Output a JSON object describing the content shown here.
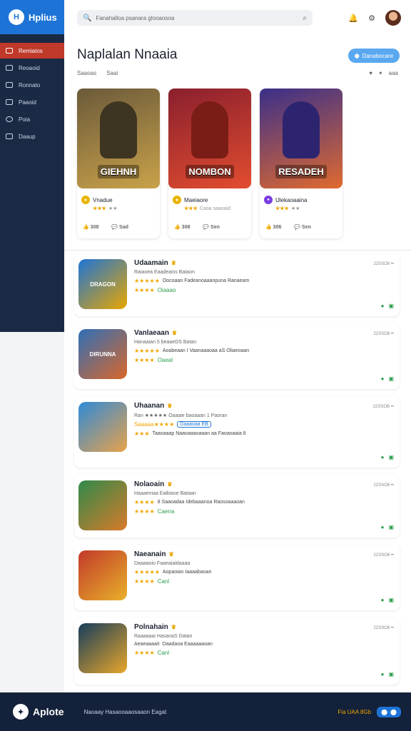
{
  "brand": {
    "name": "Hplius",
    "mark": "H"
  },
  "sidebar": {
    "items": [
      {
        "label": "Remiatos",
        "icon": "gamepad-icon"
      },
      {
        "label": "Reoaoid",
        "icon": "monitor-icon"
      },
      {
        "label": "Ronnato",
        "icon": "book-icon"
      },
      {
        "label": "Paaoid",
        "icon": "card-icon"
      },
      {
        "label": "Poia",
        "icon": "circle-icon"
      },
      {
        "label": "Daaup",
        "icon": "folder-icon"
      }
    ]
  },
  "header": {
    "search_value": "Fanahalloa psanara glooaosoa",
    "search_icon": "🔍",
    "search_action_icon": "⌕",
    "icons": [
      "🔔",
      "⚙"
    ]
  },
  "main": {
    "title": "Naplalan Nnaaia",
    "primary_button": "Danabocare",
    "primary_button_icon": "⬤",
    "sub_left": [
      "Saaoas",
      "Saai"
    ],
    "sub_right": [
      "♥",
      "✦",
      "aaa"
    ]
  },
  "featured": [
    {
      "banner": "GIEHNH",
      "name": "Vnadue",
      "stars": "★★★",
      "rating": "★★",
      "likes": "308",
      "comments": "Sad",
      "colors": [
        "#6b5a3a",
        "#c9a24a"
      ],
      "coin": "#e8b400"
    },
    {
      "banner": "NOMBON",
      "name": "Maeiaore",
      "stars": "★★★",
      "rating": "Caoa saaoaid",
      "likes": "308",
      "comments": "Sen",
      "colors": [
        "#8a1f2e",
        "#e24d2f"
      ],
      "coin": "#e8b400"
    },
    {
      "banner": "RESADEH",
      "name": "Ulekaoaaina",
      "stars": "★★★",
      "rating": "★★",
      "likes": "306",
      "comments": "Sen",
      "colors": [
        "#3a2f8a",
        "#e06a2f"
      ],
      "coin": "#7a3ee0"
    }
  ],
  "list": [
    {
      "name": "Udaamain",
      "line1": "Raiaoea Eaadeaiss Bataon",
      "stars": "★★★★★",
      "desc": "Oocoaan Fadeanoaaanpuna Ranaeam",
      "tag_stars": "★★★★",
      "tag": "Oiaaao",
      "date": "22SSO8",
      "icon_label": "DRAGON",
      "colors": [
        "#1e74d6",
        "#e8a600"
      ]
    },
    {
      "name": "Vanlaeaan",
      "line1": "Hanaaian 5 beaaeDS Batan",
      "stars": "★★★★★",
      "desc": "Aoabeaan I Vaanaaaoaa aS Oliaeoaan",
      "tag_stars": "★★★★",
      "tag": "Oaeal",
      "date": "22SSO8",
      "icon_label": "DIRUNNA",
      "colors": [
        "#2f6fb8",
        "#d9672a"
      ]
    },
    {
      "name": "Uhaanan",
      "line1": "Ran ★★★★★ Oaaaie baoaaan 1 Paoran",
      "stars": "Saaaaa★★★★",
      "desc": "Taaoaaap Naaoaaaoaaan aa Faoaoaaia 8",
      "tag_stars": "★★★",
      "tag": "",
      "date": "22SSOB",
      "icon_label": "",
      "colors": [
        "#2f8ad8",
        "#e8a24a"
      ],
      "badge": "Daaaoaa EB"
    },
    {
      "name": "Nolaoain",
      "line1": "Haaaeniaa Eaibiase Bataan",
      "stars": "★★★★",
      "desc": "8 Saaoadaa Idebaaanoa Raosoaaaoan",
      "tag_stars": "★★★★",
      "tag": "Caena",
      "date": "22SSO8",
      "icon_label": "",
      "colors": [
        "#2e8a4a",
        "#d97a2a"
      ]
    },
    {
      "name": "Naeanain",
      "line1": "Daaaaoio Faaeaiaidaaaa",
      "stars": "★★★★★",
      "desc": "Aopaoian Iaaaabaoan",
      "tag_stars": "★★★★",
      "tag": "Canl",
      "date": "22SSO8",
      "icon_label": "",
      "colors": [
        "#c23a2a",
        "#e8b02a"
      ]
    },
    {
      "name": "Polnahain",
      "line1": "Raaaaaai HasanaS Datan",
      "stars": "Aeaeaaaait",
      "desc": "Oaadaoa Eaaaaaaoan",
      "tag_stars": "★★★★",
      "tag": "Canl",
      "date": "22SSO8",
      "icon_label": "",
      "colors": [
        "#163d5c",
        "#e8a62a"
      ]
    }
  ],
  "footer": {
    "logo": "Aplote",
    "text": "Naoaay Hasaooaaosaaon Eagat",
    "meta": "Fia UAA 8Gb",
    "pill": [
      "⬤",
      "⬤"
    ]
  }
}
